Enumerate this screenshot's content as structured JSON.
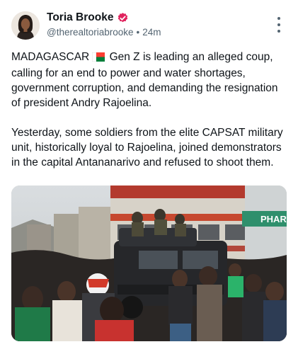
{
  "author": {
    "display_name": "Toria Brooke",
    "handle": "@therealtoriabrooke",
    "separator": "•",
    "timestamp": "24m",
    "avatar_icon": "profile-photo-avatar",
    "verified_icon": "verified-badge-icon"
  },
  "post": {
    "paragraph1_start": "MADAGASCAR",
    "flag_icon": "madagascar-flag-icon",
    "paragraph1_rest": "Gen Z is leading an alleged coup, calling for an end to power and water shortages, government corruption, and demanding the resignation of president Andry Rajoelina.",
    "paragraph2": "Yesterday, some soldiers from the elite CAPSAT military unit, historically loyal to Rajoelina, joined demonstrators in the capital Antananarivo and refused to shoot them.",
    "media_sign_text": "PHAR"
  },
  "colors": {
    "text": "#0f1419",
    "secondary_text": "#536471",
    "verified_accent": "#e0245e",
    "flag_white": "#ffffff",
    "flag_red": "#fc3d32",
    "flag_green": "#007e3a"
  }
}
